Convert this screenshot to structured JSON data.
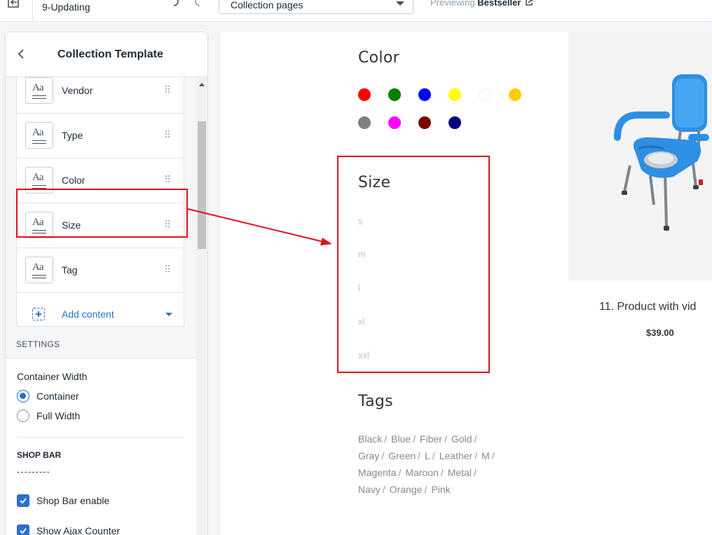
{
  "topbar": {
    "theme_name": "9-Updating",
    "page_select": "Collection pages",
    "previewing_label": "Previewing",
    "previewing_value": "Bestseller"
  },
  "sidebar": {
    "title": "Collection Template",
    "blocks": [
      {
        "label": "Vendor"
      },
      {
        "label": "Type"
      },
      {
        "label": "Color"
      },
      {
        "label": "Size"
      },
      {
        "label": "Tag"
      }
    ],
    "add_content": "Add content",
    "settings_heading": "SETTINGS",
    "container_width_label": "Container Width",
    "container_width_options": [
      {
        "label": "Container",
        "selected": true
      },
      {
        "label": "Full Width",
        "selected": false
      }
    ],
    "shop_bar_heading": "SHOP BAR",
    "dashes": "---------",
    "checkboxes": [
      {
        "label": "Shop Bar enable",
        "checked": true
      },
      {
        "label": "Show Ajax Counter",
        "checked": true
      }
    ]
  },
  "preview": {
    "color_heading": "Color",
    "colors": [
      "#ff0000",
      "#008000",
      "#0000ff",
      "#ffff00",
      "#ffffff",
      "#ffcc00",
      "#808080",
      "#ff00ff",
      "#800000",
      "#000080"
    ],
    "size_heading": "Size",
    "sizes": [
      "s",
      "m",
      "l",
      "xl",
      "xxl"
    ],
    "tags_heading": "Tags",
    "tags": [
      [
        "Black",
        "Blue",
        "Fiber",
        "Gold"
      ],
      [
        "Gray",
        "Green",
        "L",
        "Leather",
        "M"
      ],
      [
        "Magenta",
        "Maroon",
        "Metal"
      ],
      [
        "Navy",
        "Orange",
        "Pink"
      ]
    ],
    "product": {
      "title": "11. Product with vid",
      "price": "$39.00"
    }
  },
  "accent_color": "#2c6ecb",
  "highlight_color": "#e0121a"
}
